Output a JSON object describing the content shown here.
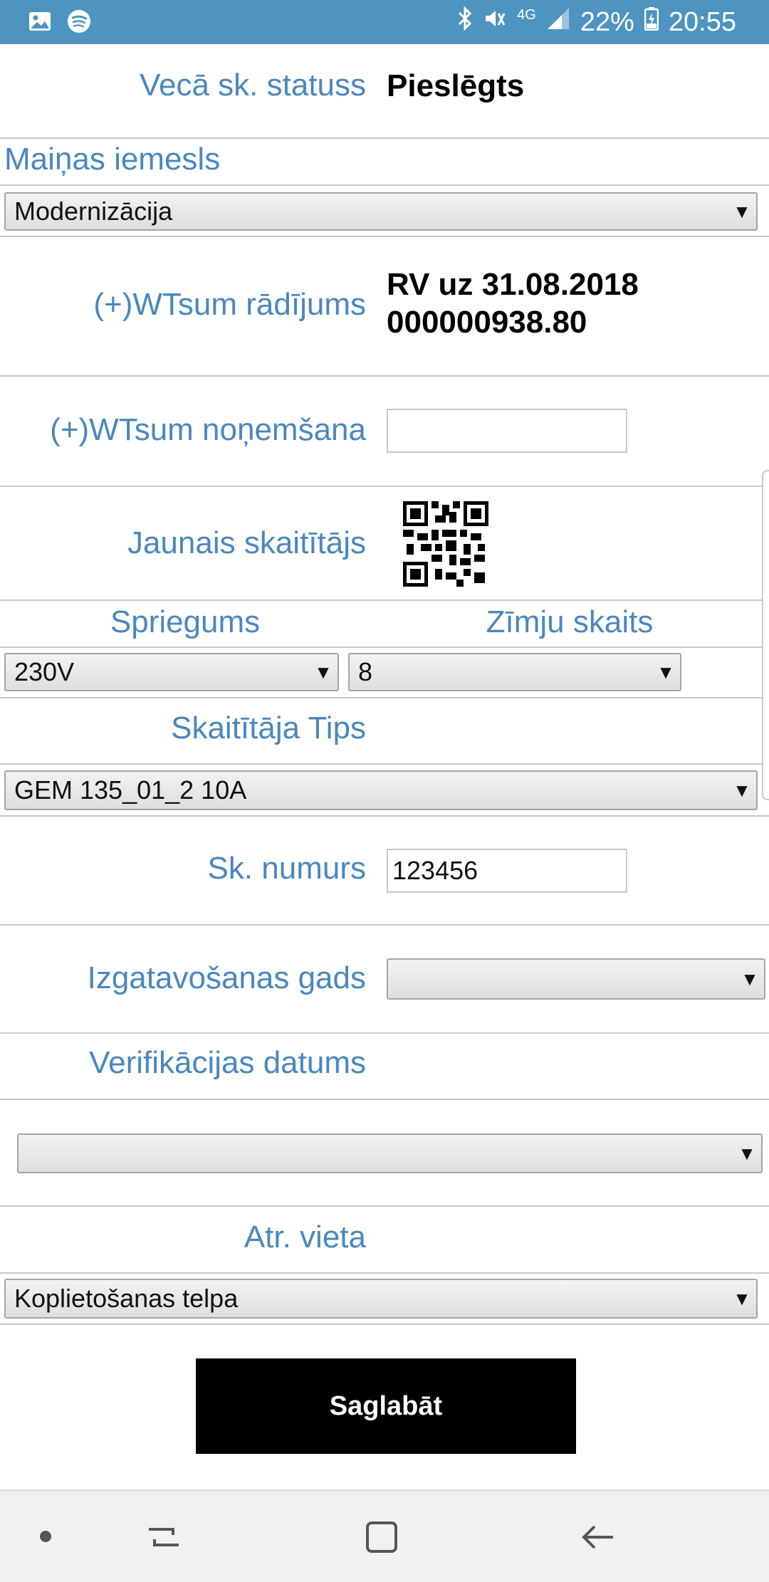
{
  "status_bar": {
    "network": "4G",
    "battery": "22%",
    "time": "20:55"
  },
  "form": {
    "old_status": {
      "label": "Vecā sk. statuss",
      "value": "Pieslēgts"
    },
    "change_reason": {
      "label": "Maiņas iemesls",
      "selected": "Modernizācija"
    },
    "reading": {
      "label": "(+)WTsum rādījums",
      "line1": "RV uz 31.08.2018",
      "line2": "000000938.80"
    },
    "removal": {
      "label": "(+)WTsum noņemšana",
      "value": ""
    },
    "new_meter": {
      "label": "Jaunais skaitītājs"
    },
    "voltage": {
      "label": "Spriegums",
      "selected": "230V"
    },
    "digits": {
      "label": "Zīmju skaits",
      "selected": "8"
    },
    "meter_type": {
      "label": "Skaitītāja Tips",
      "selected": "GEM 135_01_2 10A"
    },
    "meter_number": {
      "label": "Sk. numurs",
      "value": "123456"
    },
    "manufacture_year": {
      "label": "Izgatavošanas gads",
      "selected": ""
    },
    "verification_date": {
      "label": "Verifikācijas datums",
      "selected": ""
    },
    "location": {
      "label": "Atr. vieta",
      "selected": "Koplietošanas telpa"
    },
    "save_label": "Saglabāt"
  },
  "icons": {
    "gallery": "image-icon",
    "spotify": "spotify-icon",
    "bluetooth": "bluetooth-icon",
    "mute": "mute-icon",
    "signal": "signal-icon",
    "battery": "battery-icon",
    "qr": "qr-code-icon",
    "dropdown": "chevron-down-icon"
  },
  "colors": {
    "status_bar": "#4d94c1",
    "label": "#4a87bf",
    "button": "#000000"
  }
}
